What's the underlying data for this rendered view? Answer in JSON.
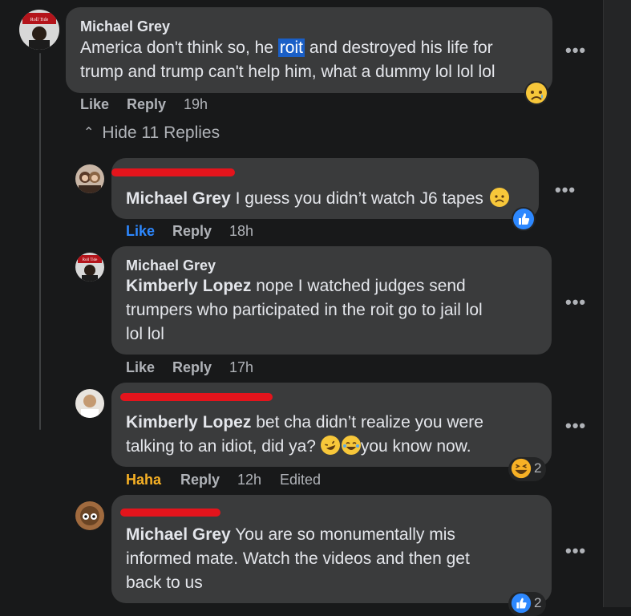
{
  "comment": {
    "author": "Michael Grey",
    "avatar_badge": "Roll Tide",
    "text_line1_before": "America don't think so, he ",
    "text_line1_selected": "roit",
    "text_line1_after": " and destroyed his life for",
    "text_line2": "trump and trump can't help him, what a dummy lol lol lol",
    "like_label": "Like",
    "reply_label": "Reply",
    "time": "19h",
    "reaction": "sad-face"
  },
  "hide_replies_label": "Hide 11 Replies",
  "replies": [
    {
      "mention": "Michael Grey",
      "text": " I guess you didn’t watch J6 tapes",
      "like_label": "Like",
      "reply_label": "Reply",
      "time": "18h",
      "reaction": "like"
    },
    {
      "author": "Michael Grey",
      "avatar_badge": "Roll Tide",
      "mention": "Kimberly Lopez",
      "line1": " nope I watched judges send",
      "line2": "trumpers who participated in the roit go to jail lol",
      "line3": "lol lol",
      "like_label": "Like",
      "reply_label": "Reply",
      "time": "17h"
    },
    {
      "mention": "Kimberly Lopez",
      "line1": " bet cha didn’t realize you were",
      "line2_before": "talking to an idiot, did ya? ",
      "line2_after": "you know now.",
      "like_label": "Haha",
      "reply_label": "Reply",
      "time": "12h",
      "edited_label": "Edited",
      "reaction": "haha",
      "reaction_count": "2"
    },
    {
      "mention": "Michael Grey",
      "line1": " You are so monumentally mis",
      "line2": "informed mate. Watch the videos and then get",
      "line3": "back to us",
      "reaction": "like",
      "reaction_count": "2"
    }
  ],
  "more_icon": "•••",
  "colors": {
    "like_blue": "#2d88ff",
    "haha_orange": "#f7b125",
    "selection": "#1a5fc7",
    "redaction": "#e4141c"
  }
}
